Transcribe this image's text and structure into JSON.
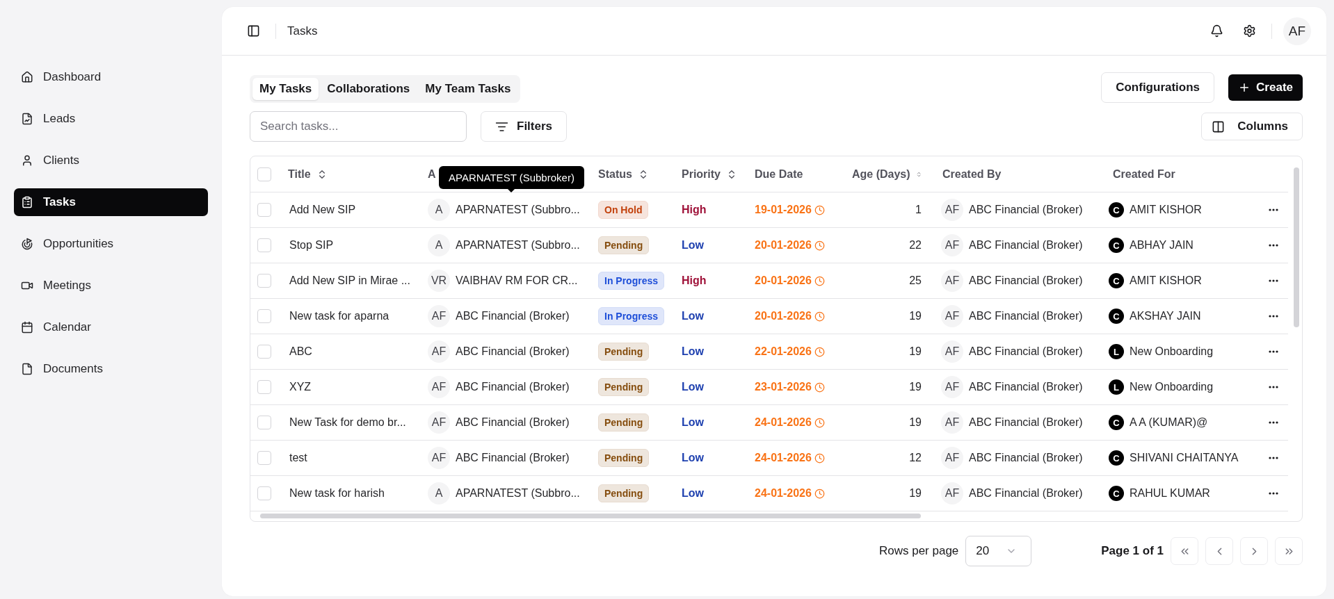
{
  "sidebar": {
    "items": [
      {
        "label": "Dashboard",
        "selected": false
      },
      {
        "label": "Leads",
        "selected": false
      },
      {
        "label": "Clients",
        "selected": false
      },
      {
        "label": "Tasks",
        "selected": true
      },
      {
        "label": "Opportunities",
        "selected": false
      },
      {
        "label": "Meetings",
        "selected": false
      },
      {
        "label": "Calendar",
        "selected": false
      },
      {
        "label": "Documents",
        "selected": false
      }
    ]
  },
  "header": {
    "breadcrumb": "Tasks",
    "avatar": "AF"
  },
  "tabs": [
    {
      "label": "My Tasks",
      "selected": true
    },
    {
      "label": "Collaborations",
      "selected": false
    },
    {
      "label": "My Team Tasks",
      "selected": false
    }
  ],
  "actions": {
    "configurations": "Configurations",
    "create": "Create",
    "filters": "Filters",
    "columns": "Columns"
  },
  "search": {
    "placeholder": "Search tasks..."
  },
  "table": {
    "select_all_checked": false,
    "columns": [
      {
        "label": "Title",
        "sortable": true
      },
      {
        "label": "A"
      },
      {
        "label": "Status",
        "sortable": true
      },
      {
        "label": "Priority",
        "sortable": true
      },
      {
        "label": "Due Date",
        "sortable": false
      },
      {
        "label": "Age (Days)",
        "sortable": true
      },
      {
        "label": "Created By",
        "sortable": false
      },
      {
        "label": "Created For",
        "sortable": false
      }
    ],
    "tooltip": "APARNATEST (Subbroker)",
    "rows": [
      {
        "checked": false,
        "title": "Add New SIP",
        "assignee_initials": "A",
        "assignee": "APARNATEST (Subbro...",
        "status": {
          "label": "On Hold",
          "color": "#c2410c"
        },
        "priority": {
          "label": "High",
          "color": "#9f1239"
        },
        "due": "19-01-2026",
        "age": "1",
        "creator_initials": "AF",
        "creator": "ABC Financial (Broker)",
        "for_initial": "C",
        "for": "AMIT KISHOR"
      },
      {
        "checked": false,
        "title": "Stop SIP",
        "assignee_initials": "A",
        "assignee": "APARNATEST (Subbro...",
        "status": {
          "label": "Pending",
          "color": "#854d0e"
        },
        "priority": {
          "label": "Low",
          "color": "#1e40af"
        },
        "due": "20-01-2026",
        "age": "22",
        "creator_initials": "AF",
        "creator": "ABC Financial (Broker)",
        "for_initial": "C",
        "for": "ABHAY JAIN"
      },
      {
        "checked": false,
        "title": "Add New SIP in Mirae ...",
        "assignee_initials": "VR",
        "assignee": "VAIBHAV RM FOR CR...",
        "status": {
          "label": "In Progress",
          "color": "#1d4ed8"
        },
        "priority": {
          "label": "High",
          "color": "#9f1239"
        },
        "due": "20-01-2026",
        "age": "25",
        "creator_initials": "AF",
        "creator": "ABC Financial (Broker)",
        "for_initial": "C",
        "for": "AMIT KISHOR"
      },
      {
        "checked": false,
        "title": "New task for aparna",
        "assignee_initials": "AF",
        "assignee": "ABC Financial (Broker)",
        "status": {
          "label": "In Progress",
          "color": "#1d4ed8"
        },
        "priority": {
          "label": "Low",
          "color": "#1e40af"
        },
        "due": "20-01-2026",
        "age": "19",
        "creator_initials": "AF",
        "creator": "ABC Financial (Broker)",
        "for_initial": "C",
        "for": "AKSHAY JAIN"
      },
      {
        "checked": false,
        "title": "ABC",
        "assignee_initials": "AF",
        "assignee": "ABC Financial (Broker)",
        "status": {
          "label": "Pending",
          "color": "#854d0e"
        },
        "priority": {
          "label": "Low",
          "color": "#1e40af"
        },
        "due": "22-01-2026",
        "age": "19",
        "creator_initials": "AF",
        "creator": "ABC Financial (Broker)",
        "for_initial": "L",
        "for": "New Onboarding"
      },
      {
        "checked": false,
        "title": "XYZ",
        "assignee_initials": "AF",
        "assignee": "ABC Financial (Broker)",
        "status": {
          "label": "Pending",
          "color": "#854d0e"
        },
        "priority": {
          "label": "Low",
          "color": "#1e40af"
        },
        "due": "23-01-2026",
        "age": "19",
        "creator_initials": "AF",
        "creator": "ABC Financial (Broker)",
        "for_initial": "L",
        "for": "New Onboarding"
      },
      {
        "checked": false,
        "title": "New Task for demo br...",
        "assignee_initials": "AF",
        "assignee": "ABC Financial (Broker)",
        "status": {
          "label": "Pending",
          "color": "#854d0e"
        },
        "priority": {
          "label": "Low",
          "color": "#1e40af"
        },
        "due": "24-01-2026",
        "age": "19",
        "creator_initials": "AF",
        "creator": "ABC Financial (Broker)",
        "for_initial": "C",
        "for": "A A (KUMAR)@"
      },
      {
        "checked": false,
        "title": "test",
        "assignee_initials": "AF",
        "assignee": "ABC Financial (Broker)",
        "status": {
          "label": "Pending",
          "color": "#854d0e"
        },
        "priority": {
          "label": "Low",
          "color": "#1e40af"
        },
        "due": "24-01-2026",
        "age": "12",
        "creator_initials": "AF",
        "creator": "ABC Financial (Broker)",
        "for_initial": "C",
        "for": "SHIVANI CHAITANYA"
      },
      {
        "checked": false,
        "title": "New task for harish",
        "assignee_initials": "A",
        "assignee": "APARNATEST (Subbro...",
        "status": {
          "label": "Pending",
          "color": "#854d0e"
        },
        "priority": {
          "label": "Low",
          "color": "#1e40af"
        },
        "due": "24-01-2026",
        "age": "19",
        "creator_initials": "AF",
        "creator": "ABC Financial (Broker)",
        "for_initial": "C",
        "for": "RAHUL KUMAR"
      }
    ]
  },
  "pagination": {
    "rows_label": "Rows per page",
    "rows_value": "20",
    "page_label": "Page 1 of 1"
  }
}
